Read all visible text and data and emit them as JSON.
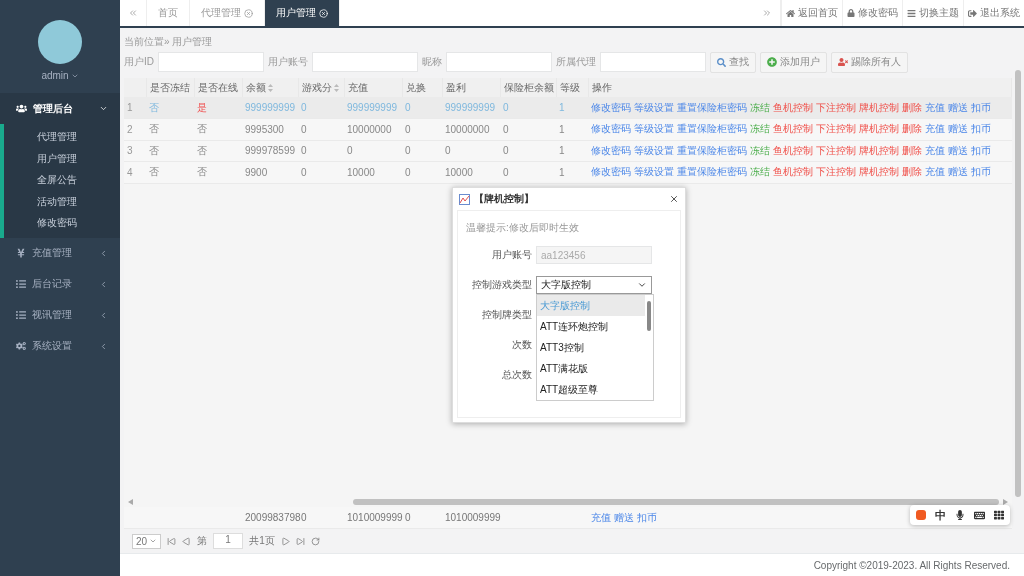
{
  "sidebar": {
    "user": "admin",
    "groups": [
      {
        "label": "管理后台",
        "expanded": true,
        "children": [
          {
            "label": "代理管理",
            "selected": false
          },
          {
            "label": "用户管理",
            "selected": false
          },
          {
            "label": "全屏公告",
            "selected": false
          },
          {
            "label": "活动管理",
            "selected": false
          },
          {
            "label": "修改密码",
            "selected": false
          }
        ]
      },
      {
        "label": "充值管理",
        "expanded": false
      },
      {
        "label": "后台记录",
        "expanded": false
      },
      {
        "label": "视讯管理",
        "expanded": false
      },
      {
        "label": "系统设置",
        "expanded": false
      }
    ]
  },
  "tabs": [
    {
      "label": "首页",
      "closable": false,
      "selected": false
    },
    {
      "label": "代理管理",
      "closable": true,
      "selected": false
    },
    {
      "label": "用户管理",
      "closable": true,
      "selected": true
    }
  ],
  "top_actions": [
    {
      "label": "返回首页"
    },
    {
      "label": "修改密码"
    },
    {
      "label": "切换主题"
    },
    {
      "label": "退出系统"
    }
  ],
  "breadcrumb": "当前位置» 用户管理",
  "filters": [
    {
      "label": "用户ID"
    },
    {
      "label": "用户账号"
    },
    {
      "label": "昵称"
    },
    {
      "label": "所属代理"
    }
  ],
  "filter_buttons": [
    {
      "label": "查找"
    },
    {
      "label": "添加用户"
    },
    {
      "label": "踢除所有人"
    }
  ],
  "table": {
    "columns": [
      {
        "label": "是否冻结"
      },
      {
        "label": "是否在线"
      },
      {
        "label": "余额",
        "sortable": true
      },
      {
        "label": "游戏分",
        "sortable": true
      },
      {
        "label": "充值"
      },
      {
        "label": "兑换"
      },
      {
        "label": "盈利"
      },
      {
        "label": "保险柜余额"
      },
      {
        "label": "等级"
      },
      {
        "label": "操作"
      }
    ],
    "rows": [
      {
        "index": "1",
        "selected": true,
        "cells": [
          {
            "text": "否",
            "kind": "plain"
          },
          {
            "text": "是",
            "kind": "alert"
          },
          {
            "text": "999999999",
            "kind": "plain"
          },
          {
            "text": "0",
            "kind": "plain"
          },
          {
            "text": "999999999",
            "kind": "plain"
          },
          {
            "text": "0",
            "kind": "plain"
          },
          {
            "text": "999999999",
            "kind": "plain"
          },
          {
            "text": "0",
            "kind": "plain"
          },
          {
            "text": "1",
            "kind": "plain"
          }
        ],
        "actions": [
          {
            "label": "修改密码",
            "kind": "info"
          },
          {
            "label": "等级设置",
            "kind": "info"
          },
          {
            "label": "重置保险柜密码",
            "kind": "info"
          },
          {
            "label": "冻结",
            "kind": "success"
          },
          {
            "label": "鱼机控制",
            "kind": "danger"
          },
          {
            "label": "下注控制",
            "kind": "danger"
          },
          {
            "label": "牌机控制",
            "kind": "danger"
          },
          {
            "label": "删除",
            "kind": "danger"
          },
          {
            "label": "充值",
            "kind": "info"
          },
          {
            "label": "赠送",
            "kind": "info"
          },
          {
            "label": "扣币",
            "kind": "info"
          }
        ]
      },
      {
        "index": "2",
        "selected": false,
        "cells": [
          {
            "text": "否",
            "kind": "plain"
          },
          {
            "text": "否",
            "kind": "plain"
          },
          {
            "text": "9995300",
            "kind": "plain"
          },
          {
            "text": "0",
            "kind": "plain"
          },
          {
            "text": "10000000",
            "kind": "plain"
          },
          {
            "text": "0",
            "kind": "plain"
          },
          {
            "text": "10000000",
            "kind": "plain"
          },
          {
            "text": "0",
            "kind": "plain"
          },
          {
            "text": "1",
            "kind": "plain"
          }
        ],
        "actions": [
          {
            "label": "修改密码",
            "kind": "info"
          },
          {
            "label": "等级设置",
            "kind": "info"
          },
          {
            "label": "重置保险柜密码",
            "kind": "info"
          },
          {
            "label": "冻结",
            "kind": "success"
          },
          {
            "label": "鱼机控制",
            "kind": "danger"
          },
          {
            "label": "下注控制",
            "kind": "danger"
          },
          {
            "label": "牌机控制",
            "kind": "danger"
          },
          {
            "label": "删除",
            "kind": "danger"
          },
          {
            "label": "充值",
            "kind": "info"
          },
          {
            "label": "赠送",
            "kind": "info"
          },
          {
            "label": "扣币",
            "kind": "info"
          }
        ]
      },
      {
        "index": "3",
        "selected": false,
        "cells": [
          {
            "text": "否",
            "kind": "plain"
          },
          {
            "text": "否",
            "kind": "plain"
          },
          {
            "text": "999978599",
            "kind": "plain"
          },
          {
            "text": "0",
            "kind": "plain"
          },
          {
            "text": "0",
            "kind": "plain"
          },
          {
            "text": "0",
            "kind": "plain"
          },
          {
            "text": "0",
            "kind": "plain"
          },
          {
            "text": "0",
            "kind": "plain"
          },
          {
            "text": "1",
            "kind": "plain"
          }
        ],
        "actions": [
          {
            "label": "修改密码",
            "kind": "info"
          },
          {
            "label": "等级设置",
            "kind": "info"
          },
          {
            "label": "重置保险柜密码",
            "kind": "info"
          },
          {
            "label": "冻结",
            "kind": "success"
          },
          {
            "label": "鱼机控制",
            "kind": "danger"
          },
          {
            "label": "下注控制",
            "kind": "danger"
          },
          {
            "label": "牌机控制",
            "kind": "danger"
          },
          {
            "label": "删除",
            "kind": "danger"
          },
          {
            "label": "充值",
            "kind": "info"
          },
          {
            "label": "赠送",
            "kind": "info"
          },
          {
            "label": "扣币",
            "kind": "info"
          }
        ]
      },
      {
        "index": "4",
        "selected": false,
        "cells": [
          {
            "text": "否",
            "kind": "plain"
          },
          {
            "text": "否",
            "kind": "plain"
          },
          {
            "text": "9900",
            "kind": "plain"
          },
          {
            "text": "0",
            "kind": "plain"
          },
          {
            "text": "10000",
            "kind": "plain"
          },
          {
            "text": "0",
            "kind": "plain"
          },
          {
            "text": "10000",
            "kind": "plain"
          },
          {
            "text": "0",
            "kind": "plain"
          },
          {
            "text": "1",
            "kind": "plain"
          }
        ],
        "actions": [
          {
            "label": "修改密码",
            "kind": "info"
          },
          {
            "label": "等级设置",
            "kind": "info"
          },
          {
            "label": "重置保险柜密码",
            "kind": "info"
          },
          {
            "label": "冻结",
            "kind": "success"
          },
          {
            "label": "鱼机控制",
            "kind": "danger"
          },
          {
            "label": "下注控制",
            "kind": "danger"
          },
          {
            "label": "牌机控制",
            "kind": "danger"
          },
          {
            "label": "删除",
            "kind": "danger"
          },
          {
            "label": "充值",
            "kind": "info"
          },
          {
            "label": "赠送",
            "kind": "info"
          },
          {
            "label": "扣币",
            "kind": "info"
          }
        ]
      }
    ],
    "totals": {
      "cells": [
        "2009983798",
        "0",
        "1010009999",
        "0",
        "1010009999"
      ],
      "actions": [
        "充值",
        "赠送",
        "扣币"
      ]
    }
  },
  "pager": {
    "page_size": "20",
    "page_prefix": "第",
    "page": "1",
    "page_total": "共1页"
  },
  "footer": "Copyright ©2019-2023. All Rights Reserved.",
  "ime_bar": {
    "mode": "中"
  },
  "dialog": {
    "title": "【牌机控制】",
    "hint": "温馨提示:修改后即时生效",
    "account": {
      "label": "用户账号",
      "value": "aa123456",
      "disabled": true
    },
    "game_type": {
      "label": "控制游戏类型",
      "value": "大字版控制",
      "expanded": true,
      "options": [
        {
          "label": "大字版控制",
          "selected": true
        },
        {
          "label": "ATT连环炮控制",
          "selected": false
        },
        {
          "label": "ATT3控制",
          "selected": false
        },
        {
          "label": "ATT满花版",
          "selected": false
        },
        {
          "label": "ATT超级至尊",
          "selected": false
        }
      ]
    },
    "other_labels": [
      "控制牌类型",
      "次数",
      "总次数"
    ]
  }
}
